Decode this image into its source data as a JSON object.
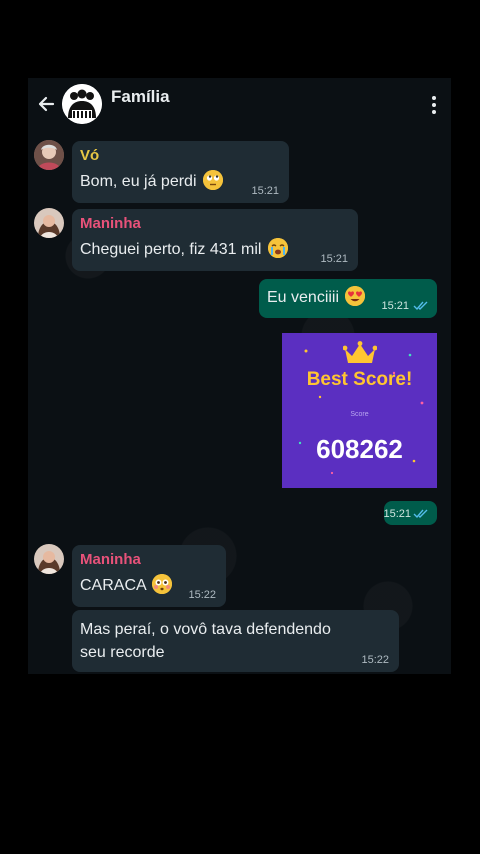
{
  "chat": {
    "title": "Família"
  },
  "messages": [
    {
      "sender": "Vó",
      "text": "Bom, eu já perdi",
      "time": "15:21"
    },
    {
      "sender": "Maninha",
      "text": "Cheguei perto, fiz 431 mil",
      "time": "15:21"
    },
    {
      "text": "Eu venciiii",
      "time": "15:21"
    },
    {
      "time": "15:21"
    },
    {
      "sender": "Maninha",
      "text": "CARACA",
      "time": "15:22"
    },
    {
      "text_line1": "Mas peraí, o vovô tava defendendo",
      "text_line2": "seu recorde",
      "time": "15:22"
    }
  ],
  "score_card": {
    "title": "Best Score!",
    "label": "Score",
    "value": "608262"
  },
  "colors": {
    "sender_vo": "#e8c845",
    "sender_maninha": "#e8527a",
    "outgoing_bubble": "#005c4b",
    "incoming_bubble": "#1f2c34",
    "read_ticks": "#53bdeb"
  },
  "icons": [
    "back-arrow-icon",
    "more-options-icon",
    "double-check-icon"
  ]
}
